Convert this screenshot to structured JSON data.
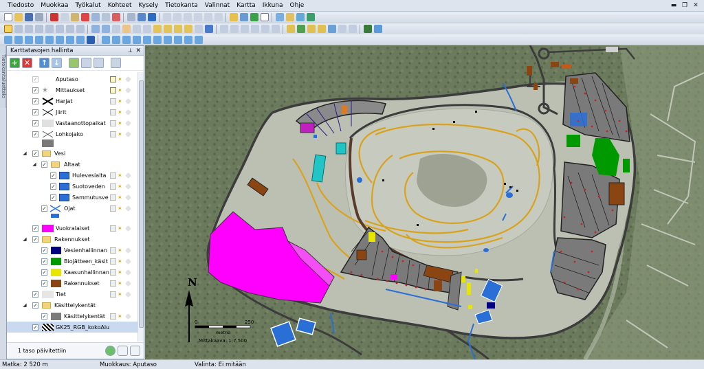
{
  "menu": [
    "Tiedosto",
    "Muokkaa",
    "Työkalut",
    "Kohteet",
    "Kysely",
    "Tietokanta",
    "Valinnat",
    "Kartta",
    "Ikkuna",
    "Ohje"
  ],
  "side_tab": "Tietokantaluettelo",
  "panel": {
    "title": "Karttatasojen hallinta",
    "pin": "⊥",
    "close": "✕",
    "footer_text": "1 taso päivitettiin"
  },
  "layers": {
    "aputaso": "Aputaso",
    "mittaukset": "Mittaukset",
    "harjat": "Harjat",
    "jiirit": "Jiirit",
    "vastaanottopaikat": "Vastaanottopaikat",
    "lohkojako": "Lohkojako",
    "vesi": "Vesi",
    "altaat": "Altaat",
    "hulevesi": "Hulevesialta",
    "suotovesi": "Suotoveden",
    "sammutusvesi": "Sammutusve",
    "ojat": "Ojat",
    "vuokralaiset": "Vuokralaiset",
    "rakennukset_group": "Rakennukset",
    "vesienhallinta": "Vesienhallinnan",
    "biojatteen": "Biojätteen_käsit",
    "kaasunhallinta": "Kaasunhallinnan",
    "rakennukset": "Rakennukset",
    "tiet": "Tiet",
    "kasittelykentat_group": "Käsittelykentät",
    "kasittelykentat": "Käsittelykentät",
    "basemap": "GK25_RGB_kokoAlu"
  },
  "map": {
    "north": "N",
    "scale_zero": "0",
    "scale_end": "250",
    "scale_unit": "metriä",
    "scale_ratio": "Mittakaava: 1:7 500"
  },
  "status": {
    "distance": "Matka: 2 520 m",
    "edit": "Muokkaus: Aputaso",
    "selection": "Valinta: Ei mitään"
  },
  "colors": {
    "vuokralaiset": "#ff00ff",
    "biojatteen": "#009900",
    "kaasunhallinta": "#e6e600",
    "rakennukset": "#8b4513",
    "vesienhallinta": "#000080",
    "altaat": "#2a6fd6",
    "tiet": "#e6e6e6",
    "kasittelykentat": "#7a7a7a",
    "roads_map": "#3c3c3c",
    "tracks": "#d9a21c",
    "cyan_field": "#22c5c5",
    "points": "#cc2222"
  }
}
